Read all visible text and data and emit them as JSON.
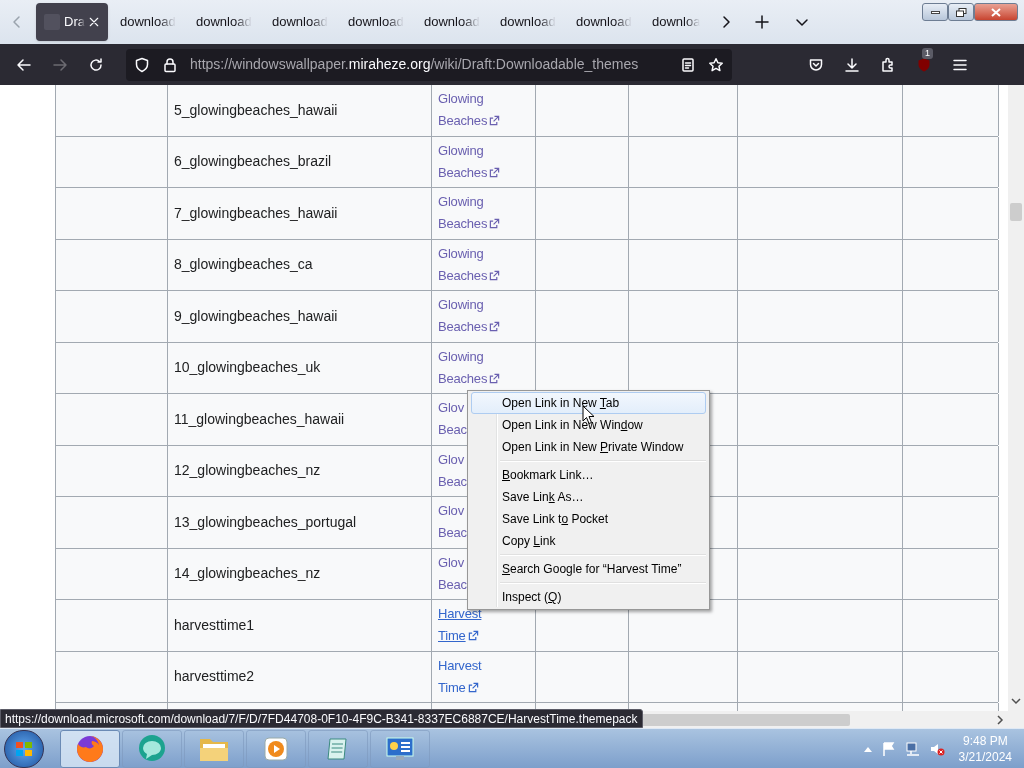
{
  "tabs": [
    {
      "label": "Dra",
      "selected": true
    },
    {
      "label": "download",
      "selected": false
    },
    {
      "label": "download",
      "selected": false
    },
    {
      "label": "download",
      "selected": false
    },
    {
      "label": "download",
      "selected": false
    },
    {
      "label": "download",
      "selected": false
    },
    {
      "label": "download",
      "selected": false
    },
    {
      "label": "download",
      "selected": false
    },
    {
      "label": "downloa",
      "selected": false
    }
  ],
  "address": {
    "prefix": "https://windowswallpaper.",
    "domain": "miraheze.org",
    "suffix": "/wiki/Draft:Downloadable_themes"
  },
  "nav": {
    "forward_disabled": true
  },
  "addon_badge": "1",
  "table": {
    "rows": [
      {
        "column_2": "5_glowingbeaches_hawaii",
        "column_3": {
          "lines": [
            "Glowing",
            "Beaches"
          ],
          "external_icon": true,
          "visited": true,
          "hovered": false
        }
      },
      {
        "column_2": "6_glowingbeaches_brazil",
        "column_3": {
          "lines": [
            "Glowing",
            "Beaches"
          ],
          "external_icon": true,
          "visited": true,
          "hovered": false
        }
      },
      {
        "column_2": "7_glowingbeaches_hawaii",
        "column_3": {
          "lines": [
            "Glowing",
            "Beaches"
          ],
          "external_icon": true,
          "visited": true,
          "hovered": false
        }
      },
      {
        "column_2": "8_glowingbeaches_ca",
        "column_3": {
          "lines": [
            "Glowing",
            "Beaches"
          ],
          "external_icon": true,
          "visited": true,
          "hovered": false
        }
      },
      {
        "column_2": "9_glowingbeaches_hawaii",
        "column_3": {
          "lines": [
            "Glowing",
            "Beaches"
          ],
          "external_icon": true,
          "visited": true,
          "hovered": false
        }
      },
      {
        "column_2": "10_glowingbeaches_uk",
        "column_3": {
          "lines": [
            "Glowing",
            "Beaches"
          ],
          "external_icon": true,
          "visited": true,
          "hovered": false
        }
      },
      {
        "column_2": "11_glowingbeaches_hawaii",
        "column_3": {
          "lines": [
            "Glov",
            "Beac"
          ],
          "external_icon": false,
          "visited": true,
          "hovered": false
        }
      },
      {
        "column_2": "12_glowingbeaches_nz",
        "column_3": {
          "lines": [
            "Glov",
            "Beac"
          ],
          "external_icon": false,
          "visited": true,
          "hovered": false
        }
      },
      {
        "column_2": "13_glowingbeaches_portugal",
        "column_3": {
          "lines": [
            "Glov",
            "Beac"
          ],
          "external_icon": false,
          "visited": true,
          "hovered": false
        }
      },
      {
        "column_2": "14_glowingbeaches_nz",
        "column_3": {
          "lines": [
            "Glov",
            "Beac"
          ],
          "external_icon": false,
          "visited": true,
          "hovered": false
        }
      },
      {
        "column_2": "harvesttime1",
        "column_3": {
          "lines": [
            "Harvest",
            "Time"
          ],
          "external_icon": true,
          "visited": false,
          "hovered": true
        }
      },
      {
        "column_2": "harvesttime2",
        "column_3": {
          "lines": [
            "Harvest",
            "Time"
          ],
          "external_icon": true,
          "visited": false,
          "hovered": false
        }
      }
    ]
  },
  "context_menu": [
    {
      "kind": "item",
      "before": "Open Link in New ",
      "key": "T",
      "after": "ab",
      "selected": true
    },
    {
      "kind": "item",
      "before": "Open Link in New Win",
      "key": "d",
      "after": "ow",
      "selected": false
    },
    {
      "kind": "item",
      "before": "Open Link in New ",
      "key": "P",
      "after": "rivate Window",
      "selected": false
    },
    {
      "kind": "separator"
    },
    {
      "kind": "item",
      "key": "B",
      "after": "ookmark Link…",
      "selected": false
    },
    {
      "kind": "item",
      "before": "Save Lin",
      "key": "k",
      "after": " As…",
      "selected": false
    },
    {
      "kind": "item",
      "before": "Save Link t",
      "key": "o",
      "after": " Pocket",
      "selected": false
    },
    {
      "kind": "item",
      "before": "Copy ",
      "key": "L",
      "after": "ink",
      "selected": false
    },
    {
      "kind": "separator"
    },
    {
      "kind": "item",
      "key": "S",
      "after": "earch Google for “Harvest Time”",
      "selected": false
    },
    {
      "kind": "separator"
    },
    {
      "kind": "item",
      "before": "Inspect (",
      "key": "Q",
      "after": ")",
      "selected": false
    }
  ],
  "status_url": "https://download.microsoft.com/download/7/F/D/7FD44708-0F10-4F9C-B341-8337EC6887CE/HarvestTime.themepack",
  "taskbar": {
    "apps": [
      {
        "kind": "firefox",
        "selected": true
      },
      {
        "kind": "bubble",
        "selected": false
      },
      {
        "kind": "folder",
        "selected": false
      },
      {
        "kind": "media",
        "selected": false
      },
      {
        "kind": "notepad",
        "selected": false
      },
      {
        "kind": "panel",
        "selected": false
      }
    ],
    "time": "9:48 PM",
    "date": "3/21/2024"
  }
}
